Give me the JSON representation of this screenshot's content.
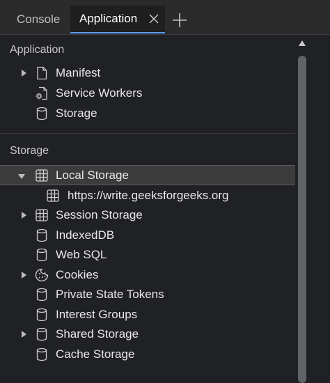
{
  "tabs": {
    "console": "Console",
    "application": "Application"
  },
  "application_section": {
    "title": "Application",
    "items": [
      {
        "label": "Manifest",
        "icon": "document-icon",
        "expandable": true
      },
      {
        "label": "Service Workers",
        "icon": "service-worker-icon",
        "expandable": false
      },
      {
        "label": "Storage",
        "icon": "database-icon",
        "expandable": false
      }
    ]
  },
  "storage_section": {
    "title": "Storage",
    "local_storage": {
      "label": "Local Storage",
      "expanded": true
    },
    "local_storage_child": {
      "label": "https://write.geeksforgeeks.org"
    },
    "items": [
      {
        "label": "Session Storage",
        "icon": "grid-icon",
        "expandable": true
      },
      {
        "label": "IndexedDB",
        "icon": "database-icon",
        "expandable": false
      },
      {
        "label": "Web SQL",
        "icon": "database-icon",
        "expandable": false
      },
      {
        "label": "Cookies",
        "icon": "cookie-icon",
        "expandable": true
      },
      {
        "label": "Private State Tokens",
        "icon": "database-icon",
        "expandable": false
      },
      {
        "label": "Interest Groups",
        "icon": "database-icon",
        "expandable": false
      },
      {
        "label": "Shared Storage",
        "icon": "database-icon",
        "expandable": true
      },
      {
        "label": "Cache Storage",
        "icon": "database-icon",
        "expandable": false
      }
    ]
  },
  "colors": {
    "accent": "#5c9cf5",
    "background": "#202124",
    "selected_row": "#3c3c3c"
  }
}
